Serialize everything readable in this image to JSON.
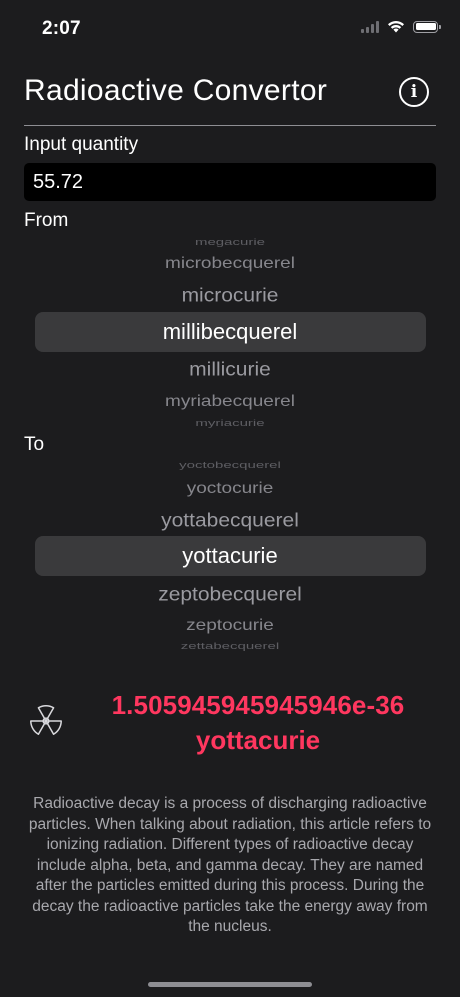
{
  "status_bar": {
    "time": "2:07",
    "icons": [
      "cellular-signal-icon",
      "wifi-icon",
      "battery-icon"
    ]
  },
  "header": {
    "title": "Radioactive Convertor",
    "info_icon": "info-circle-icon",
    "info_glyph": "i"
  },
  "input": {
    "label": "Input quantity",
    "value": "55.72"
  },
  "from": {
    "label": "From",
    "items": [
      "megacurie",
      "microbecquerel",
      "microcurie",
      "millibecquerel",
      "millicurie",
      "myriabecquerel",
      "myriacurie"
    ],
    "selected": "millibecquerel"
  },
  "to": {
    "label": "To",
    "items": [
      "yoctobecquerel",
      "yoctocurie",
      "yottabecquerel",
      "yottacurie",
      "zeptobecquerel",
      "zeptocurie",
      "zettabecquerel"
    ],
    "selected": "yottacurie"
  },
  "result": {
    "icon": "radiation-icon",
    "value": "1.505945945945946e-36",
    "unit": "yottacurie"
  },
  "description": "Radioactive decay is a process of discharging radioactive particles. When talking about radiation, this article refers to ionizing radiation. Different types of radioactive decay include alpha, beta, and gamma decay. They are named after the particles emitted during this process. During the decay the radioactive particles take the energy away from the nucleus.",
  "colors": {
    "background": "#1c1c1e",
    "accent": "#ff375f",
    "input_background": "#000000",
    "picker_highlight": "#3a3a3c"
  }
}
